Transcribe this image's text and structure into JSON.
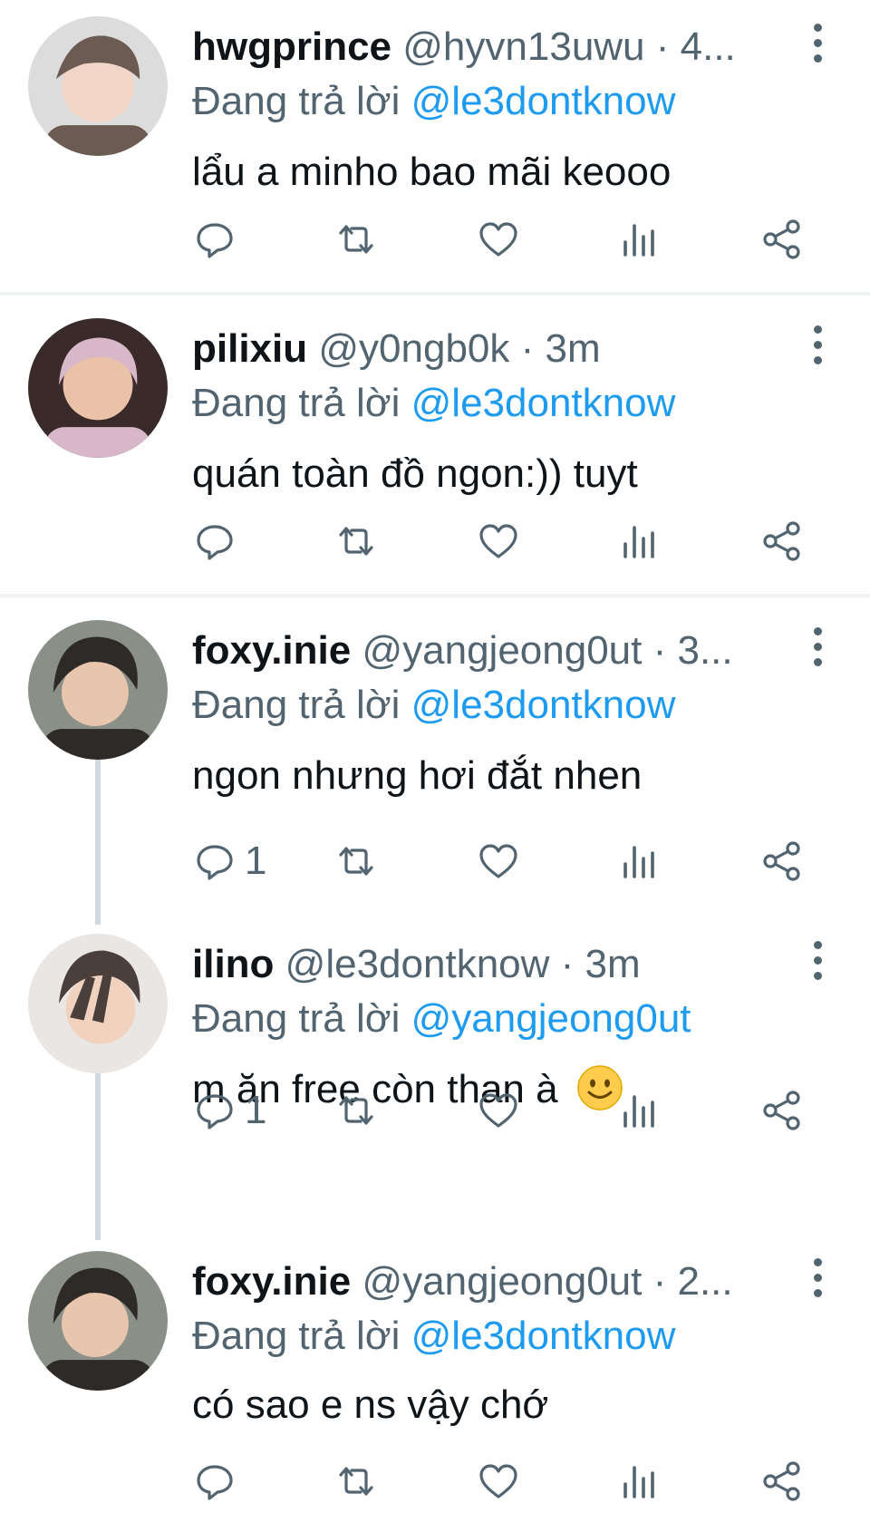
{
  "tweets": [
    {
      "display_name": "hwgprince",
      "handle": "@hyvn13uwu",
      "time": "4...",
      "reply_label": "Đang trả lời",
      "reply_to": "@le3dontknow",
      "text": "lẩu a minho bao mãi keooo",
      "reply_count": "",
      "avatar_colors": [
        "#dcdcdc",
        "#6b5b52",
        "#f1d6c8"
      ]
    },
    {
      "display_name": "pilixiu",
      "handle": "@y0ngb0k",
      "time": "3m",
      "reply_label": "Đang trả lời",
      "reply_to": "@le3dontknow",
      "text": "quán toàn đồ ngon:)) tuyt",
      "reply_count": "",
      "avatar_colors": [
        "#3a2a2a",
        "#d8b7c9",
        "#e9c2a8"
      ]
    },
    {
      "display_name": "foxy.inie",
      "handle": "@yangjeong0ut",
      "time": "3...",
      "reply_label": "Đang trả lời",
      "reply_to": "@le3dontknow",
      "text": "ngon nhưng hơi đắt nhen",
      "reply_count": "1",
      "avatar_colors": [
        "#8a8f88",
        "#2d2a28",
        "#e7c6ad"
      ]
    },
    {
      "display_name": "ilino",
      "handle": "@le3dontknow",
      "time": "3m",
      "reply_label": "Đang trả lời",
      "reply_to": "@yangjeong0ut",
      "text": "m ăn free còn than à",
      "emoji": "slightly-smiling-face",
      "reply_count": "1",
      "avatar_colors": [
        "#e9e6e3",
        "#4a3f3a",
        "#f0d2bf"
      ]
    },
    {
      "display_name": "foxy.inie",
      "handle": "@yangjeong0ut",
      "time": "2...",
      "reply_label": "Đang trả lời",
      "reply_to": "@le3dontknow",
      "text": "có sao e ns vậy chớ",
      "reply_count": "",
      "avatar_colors": [
        "#8a8f88",
        "#2d2a28",
        "#e7c6ad"
      ]
    }
  ],
  "colors": {
    "secondary_text": "#536471",
    "link": "#1d9bf0",
    "divider": "#eff3f4",
    "thread_line": "#cfd9de"
  },
  "icons": [
    "reply-icon",
    "retweet-icon",
    "like-icon",
    "views-icon",
    "share-icon",
    "more-icon"
  ]
}
